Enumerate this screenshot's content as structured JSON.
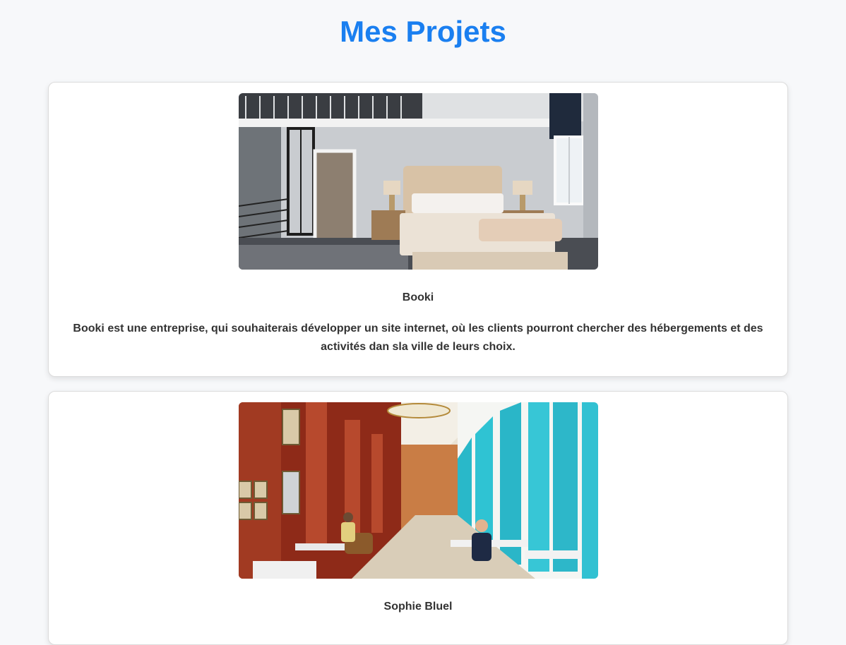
{
  "page": {
    "title": "Mes Projets"
  },
  "projects": [
    {
      "title": "Booki",
      "description": "Booki est une entreprise, qui souhaiterais développer un site internet, où les clients pourront chercher des hébergements et des activités dan sla ville de leurs choix.",
      "image_alt": "Chambre d'hôtel avec lit capitonné"
    },
    {
      "title": "Sophie Bluel",
      "description": "",
      "image_alt": "Salle de restaurant avec grandes fenêtres turquoise"
    }
  ]
}
